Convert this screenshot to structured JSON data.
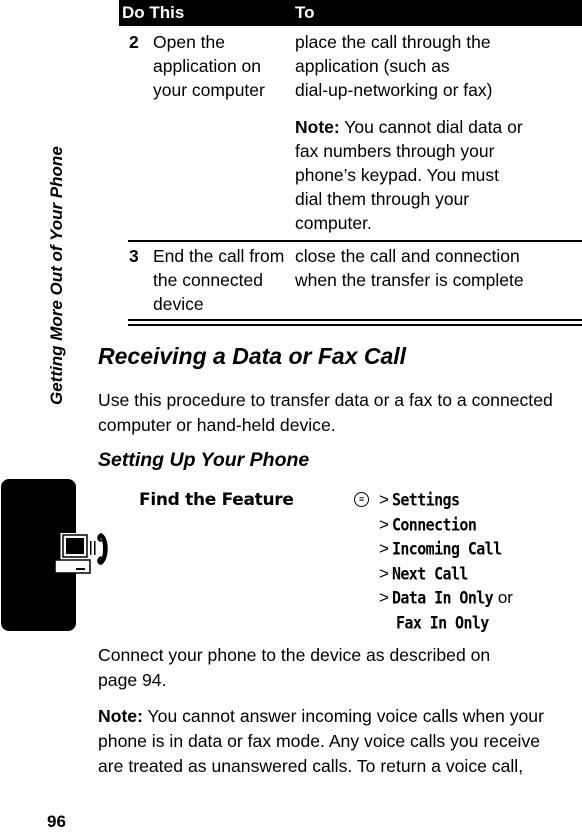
{
  "side": {
    "chapter_title": "Getting More Out of Your Phone",
    "icon": "computer-phone-icon"
  },
  "table": {
    "headers": [
      "Do This",
      "To"
    ],
    "rows": [
      {
        "step": "2",
        "action_lines": [
          "Open the",
          "application on",
          "your computer"
        ],
        "result_lines": [
          "place the call through the",
          "application (such as",
          "dial-up-networking or fax)"
        ],
        "note_label": "Note:",
        "note_lines": [
          " You cannot dial data or",
          "fax numbers through your",
          "phone’s keypad. You must",
          "dial them through your",
          "computer."
        ]
      },
      {
        "step": "3",
        "action_lines": [
          "End the call from",
          "the connected",
          "device"
        ],
        "result_lines": [
          "close the call and connection",
          "when the transfer is complete"
        ]
      }
    ]
  },
  "section": {
    "title": "Receiving a Data or Fax Call",
    "intro_lines": [
      "Use this procedure to transfer data or a fax to a connected",
      "computer or hand-held device."
    ],
    "subtitle": "Setting Up Your Phone"
  },
  "find_feature": {
    "label": "Find the Feature",
    "menu_key_icon": "menu-key-icon",
    "menu_key_glyph": "≡",
    "separator": ">",
    "path": [
      "Settings",
      "Connection",
      "Incoming Call",
      "Next Call",
      "Data In Only"
    ],
    "or_text": "or",
    "alt_option": "Fax In Only"
  },
  "body": {
    "connect_lines": [
      "Connect your phone to the device as described on",
      "page 94."
    ],
    "note_label": "Note:",
    "note_lines": [
      " You cannot answer incoming voice calls when your",
      "phone is in data or fax mode. Any voice calls you receive",
      "are treated as unanswered calls. To return a voice call,"
    ]
  },
  "page_number": "96"
}
